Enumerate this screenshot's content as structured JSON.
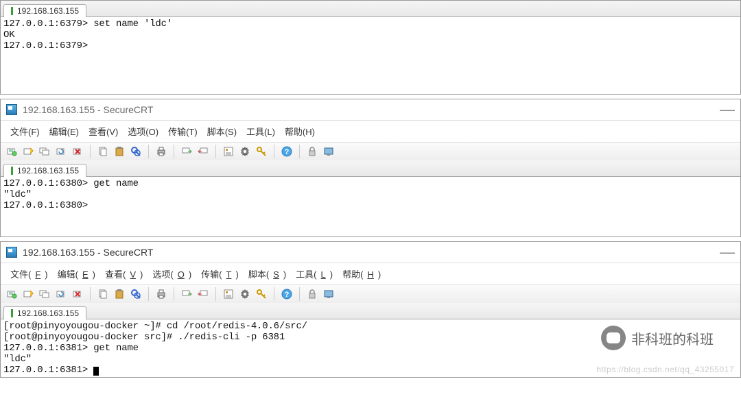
{
  "tab_ip": "192.168.163.155",
  "window1": {
    "terminal": "127.0.0.1:6379> set name 'ldc'\nOK\n127.0.0.1:6379>"
  },
  "window2": {
    "title": "192.168.163.155 - SecureCRT",
    "terminal": "127.0.0.1:6380> get name\n\"ldc\"\n127.0.0.1:6380>"
  },
  "window3": {
    "title": "192.168.163.155 - SecureCRT",
    "terminal": "[root@pinyoyougou-docker ~]# cd /root/redis-4.0.6/src/\n[root@pinyoyougou-docker src]# ./redis-cli -p 6381\n127.0.0.1:6381> get name\n\"ldc\"\n127.0.0.1:6381> "
  },
  "menu": {
    "file": "文件(F)",
    "edit": "编辑(E)",
    "view": "查看(V)",
    "options": "选项(O)",
    "transfer": "传输(T)",
    "script": "脚本(S)",
    "tools": "工具(L)",
    "help": "帮助(H)"
  },
  "watermark": "非科班的科班",
  "watermark_url": "https://blog.csdn.net/qq_43255017"
}
